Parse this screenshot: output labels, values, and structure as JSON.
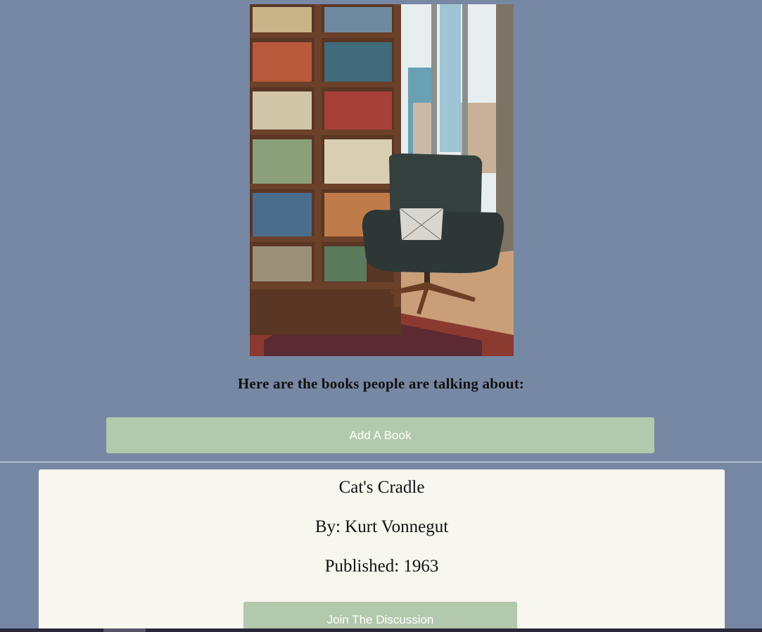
{
  "hero": {
    "alt": "Bookshelf with an armchair by a window"
  },
  "heading": "Here are the books people are talking about:",
  "add_book_button": "Add A Book",
  "books": [
    {
      "title": "Cat's Cradle",
      "author": "By: Kurt Vonnegut",
      "published": "Published: 1963",
      "join_button": "Join The Discussion"
    }
  ],
  "colors": {
    "background": "#7788a5",
    "button": "#b3c9ad",
    "card": "#f7f6ef"
  }
}
